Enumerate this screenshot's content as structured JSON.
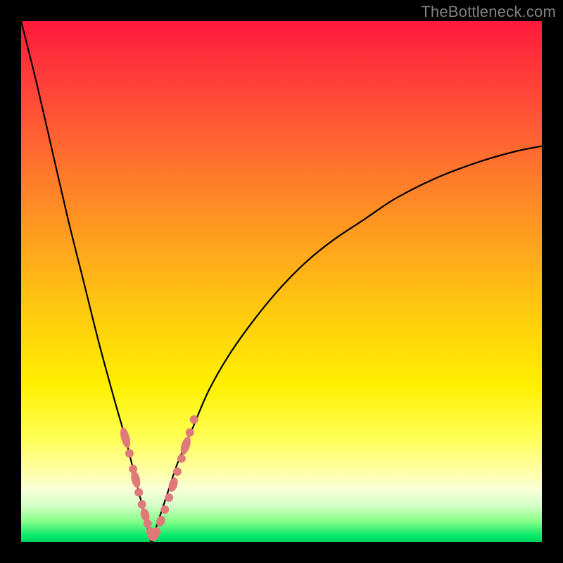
{
  "watermark": "TheBottleneck.com",
  "colors": {
    "top": "#ff1a3c",
    "mid": "#fff000",
    "bottom": "#00d060",
    "curve": "#000000",
    "beads": "#e07a7a",
    "frame": "#000000"
  },
  "chart_data": {
    "type": "line",
    "title": "",
    "xlabel": "",
    "ylabel": "",
    "xlim": [
      0,
      100
    ],
    "ylim": [
      0,
      100
    ],
    "grid": false,
    "description": "V-shaped bottleneck curve; y roughly = |x - 25| scaled, minimum at x≈25, left branch rises to ~100 at x=0, right branch rises asymptotically toward ~75 at x=100. Background gradient red→yellow→green encodes goodness (green=optimal near minimum).",
    "series": [
      {
        "name": "bottleneck-curve",
        "x": [
          0,
          3,
          6,
          9,
          12,
          15,
          18,
          20,
          22,
          24,
          25,
          26,
          28,
          30,
          33,
          36,
          40,
          45,
          50,
          55,
          60,
          66,
          72,
          80,
          88,
          95,
          100
        ],
        "y": [
          100,
          88,
          75,
          62,
          50,
          38,
          27,
          20,
          12,
          4,
          0,
          3,
          9,
          15,
          22,
          29,
          36,
          43,
          49,
          54,
          58,
          62,
          66,
          70,
          73,
          75,
          76
        ]
      },
      {
        "name": "marker-beads",
        "x": [
          20.0,
          20.8,
          21.5,
          22.0,
          22.6,
          23.2,
          23.8,
          24.3,
          24.8,
          25.2,
          25.6,
          26.0,
          26.8,
          27.6,
          28.4,
          29.2,
          30.0,
          30.8,
          31.6,
          32.4,
          33.2
        ],
        "y": [
          20.0,
          17.0,
          14.0,
          12.0,
          9.5,
          7.2,
          5.2,
          3.5,
          2.0,
          1.0,
          1.2,
          2.0,
          4.0,
          6.2,
          8.5,
          11.0,
          13.5,
          16.0,
          18.5,
          21.0,
          23.5
        ]
      }
    ]
  }
}
